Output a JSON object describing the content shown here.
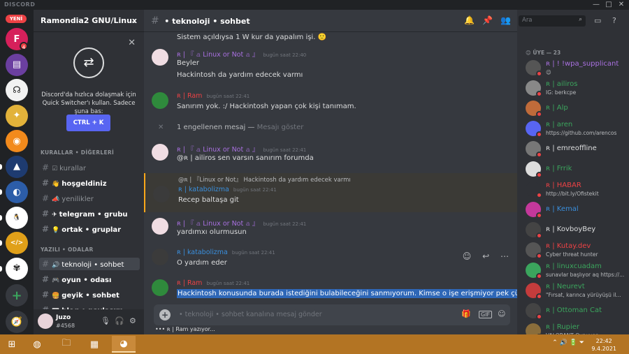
{
  "window": {
    "brand": "DISCORD",
    "controls": [
      "—",
      "□",
      "✕"
    ]
  },
  "rail": {
    "new_badge": "YENİ",
    "servers": [
      {
        "name": "F",
        "color": "#d6205b",
        "badge": "4"
      },
      {
        "name": "▤",
        "color": "#6b3fa0"
      },
      {
        "name": "☊",
        "color": "#f2f2f2"
      },
      {
        "name": "✦",
        "color": "#e2b23a"
      },
      {
        "name": "◉",
        "color": "#f28a1c"
      },
      {
        "name": "▲",
        "color": "#1e3b70"
      },
      {
        "name": "◐",
        "color": "#2c5da8"
      },
      {
        "name": "🐧",
        "color": "#ffffff"
      },
      {
        "name": "</>",
        "color": "#e0a019"
      },
      {
        "name": "✾",
        "color": "#ffffff"
      }
    ],
    "add_icon": "+",
    "explore_icon": "🧭"
  },
  "server": {
    "name": "Ramondia2 GNU/Linux"
  },
  "quick_switcher": {
    "text": "Discord'da hızlıca dolaşmak için Quick Switcher'ı kullan. Sadece şuna bas:",
    "button": "CTRL + K"
  },
  "categories": [
    {
      "label": "KURALLAR • DİĞERLERİ"
    },
    {
      "label": "YAZILI • ODALAR"
    }
  ],
  "channels": [
    {
      "label": "kurallar",
      "emoji": "☑",
      "style": ""
    },
    {
      "label": "hoşgeldiniz",
      "emoji": "👋",
      "style": "bold"
    },
    {
      "label": "yenilikler",
      "emoji": "📣",
      "style": ""
    },
    {
      "label": "telegram • grubu",
      "emoji": "✈",
      "style": "bold"
    },
    {
      "label": "ortak • gruplar",
      "emoji": "💡",
      "style": "bold"
    },
    {
      "label": "teknoloji • sohbet",
      "emoji": "🔊",
      "style": "active"
    },
    {
      "label": "oyun • odası",
      "emoji": "🎮",
      "style": "bold"
    },
    {
      "label": "geyik • sohbet",
      "emoji": "🍔",
      "style": "bold"
    },
    {
      "label": "blog • paylaşım",
      "emoji": "📰",
      "style": "bold"
    }
  ],
  "user": {
    "name": "Juzo",
    "tag": "#4568"
  },
  "channel_header": {
    "title": "• teknoloji • sohbet",
    "search_placeholder": "Ara"
  },
  "messages": [
    {
      "type": "cont",
      "body": "Sistem açıldıysa 1 W kur da yapalım işi. 🙂"
    },
    {
      "type": "full",
      "author": "ʀ | 『 𝚊 Linux or Not 𝚊 』",
      "author_color": "#a970e0",
      "time": "bugün saat 22:40",
      "avatar": "#f0dde3",
      "lines": [
        "Beyler",
        "Hackintosh da yardım edecek varmı"
      ]
    },
    {
      "type": "full",
      "author": "ʀ | Ram",
      "author_color": "#ed4245",
      "time": "bugün saat 22:41",
      "avatar": "#2f8a3c",
      "lines": [
        "Sanırım yok. :/ Hackintosh yapan çok kişi tanımam."
      ]
    },
    {
      "type": "blocked",
      "text": "1 engellenen mesaj — ",
      "link": "Mesajı göster"
    },
    {
      "type": "full",
      "author": "ʀ | 『 𝚊 Linux or Not 𝚊 』",
      "author_color": "#a970e0",
      "time": "bugün saat 22:41",
      "avatar": "#f0dde3",
      "lines": [
        "@ʀ | ailiros sen varsın sanırım forumda"
      ]
    },
    {
      "type": "reply",
      "reply_to": "@ʀ | 『Linux or Not』 Hackintosh da yardım edecek varmı",
      "author": "ʀ | katabolizma",
      "author_color": "#3a8fdd",
      "time": "bugün saat 22:41",
      "avatar": "#3b3b3b",
      "lines": [
        "Recep baltaşa git"
      ]
    },
    {
      "type": "full",
      "author": "ʀ | 『 𝚊 Linux or Not 𝚊 』",
      "author_color": "#a970e0",
      "time": "bugün saat 22:41",
      "avatar": "#f0dde3",
      "lines": [
        "yardımxı olurmusun"
      ]
    },
    {
      "type": "full",
      "author": "ʀ | katabolizma",
      "author_color": "#3a8fdd",
      "time": "bugün saat 22:41",
      "avatar": "#3b3b3b",
      "lines": [
        "O yardım eder"
      ]
    },
    {
      "type": "full",
      "author": "ʀ | Ram",
      "author_color": "#ed4245",
      "time": "bugün saat 22:41",
      "avatar": "#2f8a3c",
      "lines": [
        "Hackintosh konusunda burada istediğini bulabileceğini sanmıyorum. Kimse o işe erişmiyor pek çünkü."
      ],
      "selected": true
    }
  ],
  "composer": {
    "placeholder": "• teknoloji • sohbet kanalına mesaj gönder",
    "gif": "GIF"
  },
  "typing": "ʀ | Ram yazıyor...",
  "members": {
    "header": "😊 ÜYE — 23",
    "list": [
      {
        "name": "ʀ | ! !wpa_supplicant",
        "color": "#a970e0",
        "sub": "😉",
        "avatar": "#555"
      },
      {
        "name": "ʀ | ailiros",
        "color": "#3ba55d",
        "sub": "IG: berkcpe",
        "avatar": "#888"
      },
      {
        "name": "ʀ | Alp",
        "color": "#3ba55d",
        "sub": "",
        "avatar": "#c06b3a"
      },
      {
        "name": "ʀ | aren",
        "color": "#3ba55d",
        "sub": "https://github.com/arencos",
        "avatar": "#5865f2"
      },
      {
        "name": "ʀ | emreoffline",
        "color": "#dcddde",
        "sub": "",
        "avatar": "#777"
      },
      {
        "name": "ʀ | Frrik",
        "color": "#3ba55d",
        "sub": "",
        "avatar": "#ddd"
      },
      {
        "name": "ʀ | HABAR",
        "color": "#ed4245",
        "sub": "http://bit.ly/Ofistekit",
        "avatar": "#2f3136"
      },
      {
        "name": "ʀ | Kemal",
        "color": "#3a8fdd",
        "sub": "",
        "avatar": "#c4389b"
      },
      {
        "name": "ʀ | KovboyBey",
        "color": "#dcddde",
        "sub": "",
        "avatar": "#444"
      },
      {
        "name": "ʀ | Kutay.dev",
        "color": "#ed4245",
        "sub": "Cyber threat hunter",
        "avatar": "#555"
      },
      {
        "name": "ʀ | linuxcuadam",
        "color": "#3ba55d",
        "sub": "sunavlar başlıyor aq https://...",
        "avatar": "#3ba55d"
      },
      {
        "name": "ʀ | Neurevt",
        "color": "#3ba55d",
        "sub": "\"Fırsat, karınca yürüyüşü il...",
        "avatar": "#c43c3c"
      },
      {
        "name": "ʀ | Ottoman Cat",
        "color": "#3ba55d",
        "sub": "",
        "avatar": "#444"
      },
      {
        "name": "ʀ | Rupier",
        "color": "#3ba55d",
        "sub": "VALORANT Oynuyor",
        "avatar": "#8a6d3b"
      }
    ]
  },
  "taskbar": {
    "apps": [
      "⊞",
      "◍",
      "🗀",
      "▦",
      "◕"
    ],
    "time": "22:42",
    "date": "9.4.2021",
    "tray": "⌃  🔊  🔋  ⏷"
  }
}
